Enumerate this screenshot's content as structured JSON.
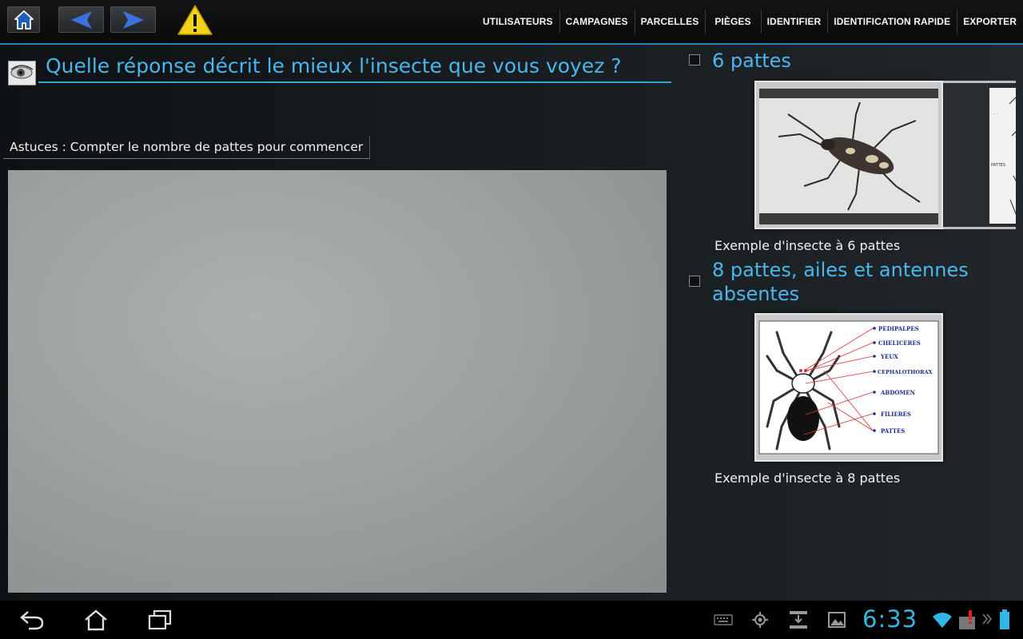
{
  "menu": [
    "UTILISATEURS",
    "CAMPAGNES",
    "PARCELLES",
    "PIÈGES",
    "IDENTIFIER",
    "IDENTIFICATION RAPIDE",
    "EXPORTER"
  ],
  "question": "Quelle réponse décrit le mieux l'insecte que vous voyez ?",
  "hint": "Astuces : Compter le nombre de pattes pour commencer",
  "options": [
    {
      "title": "6 pattes",
      "caption": "Exemple d'insecte à 6 pattes"
    },
    {
      "title_line1": "8 pattes, ailes et antennes",
      "title_line2": "absentes",
      "caption": "Exemple d'insecte à 8 pattes"
    }
  ],
  "diagram_labels": [
    "PEDIPALPES",
    "CHELICERES",
    "YEUX",
    "CEPHALOTHORAX",
    "ABDOMEN",
    "FILIERES",
    "PATTES"
  ],
  "partial_diagram_labels": [
    "PATTES"
  ],
  "status": {
    "time": "6:33"
  },
  "colors": {
    "accent": "#33b5e5",
    "question": "#4ab6ee",
    "divider": "#2a86b8"
  }
}
